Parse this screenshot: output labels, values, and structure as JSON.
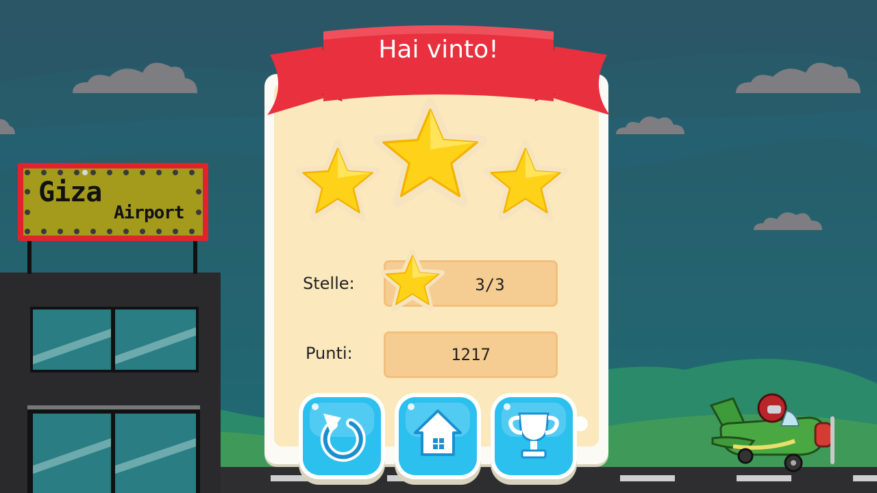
{
  "dialog": {
    "title": "Hai vinto!",
    "stars_earned": 3,
    "stars_total": 3
  },
  "stats": {
    "stars_label": "Stelle:",
    "stars_value": "3/3",
    "points_label": "Punti:",
    "points_value": "1217"
  },
  "buttons": {
    "restart_icon": "restart-icon",
    "home_icon": "home-icon",
    "trophy_icon": "trophy-icon"
  },
  "scene": {
    "sign_line1": "Giza",
    "sign_line2": "Airport"
  },
  "colors": {
    "sky": "#245f6c",
    "ribbon": "#e8303f",
    "button": "#2cc0ef",
    "panel": "#fbe8bd",
    "star": "#ffd21a"
  }
}
